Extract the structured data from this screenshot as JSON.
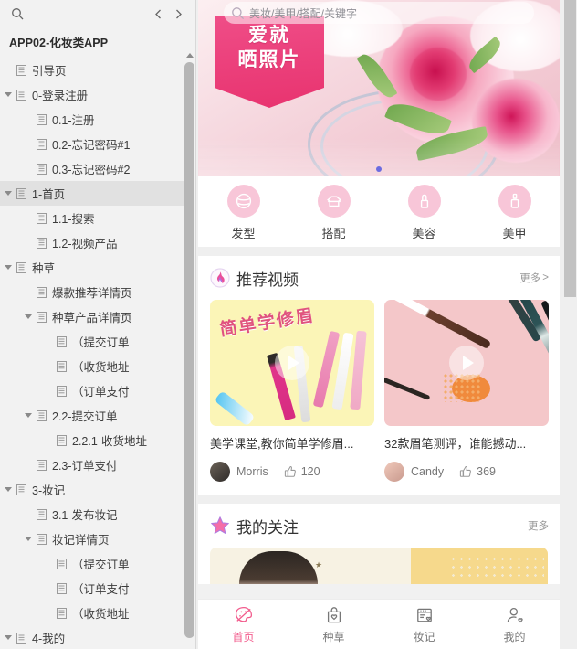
{
  "sidebar": {
    "search_icon": "search-icon",
    "nav_back_icon": "chevron-left-icon",
    "nav_forward_icon": "chevron-right-icon",
    "project_title": "APP02-化妆类APP",
    "tree": [
      {
        "label": "引导页",
        "depth": 1,
        "toggle": "none",
        "selected": false
      },
      {
        "label": "0-登录注册",
        "depth": 1,
        "toggle": "open",
        "selected": false
      },
      {
        "label": "0.1-注册",
        "depth": 2,
        "toggle": "none",
        "selected": false
      },
      {
        "label": "0.2-忘记密码#1",
        "depth": 2,
        "toggle": "none",
        "selected": false
      },
      {
        "label": "0.3-忘记密码#2",
        "depth": 2,
        "toggle": "none",
        "selected": false
      },
      {
        "label": "1-首页",
        "depth": 1,
        "toggle": "open",
        "selected": true
      },
      {
        "label": "1.1-搜索",
        "depth": 2,
        "toggle": "none",
        "selected": false
      },
      {
        "label": "1.2-视频产品",
        "depth": 2,
        "toggle": "none",
        "selected": false
      },
      {
        "label": "种草",
        "depth": 1,
        "toggle": "open",
        "selected": false
      },
      {
        "label": "爆款推荐详情页",
        "depth": 2,
        "toggle": "none",
        "selected": false
      },
      {
        "label": "种草产品详情页",
        "depth": 2,
        "toggle": "open",
        "selected": false
      },
      {
        "label": "（提交订单",
        "depth": 3,
        "toggle": "none",
        "selected": false
      },
      {
        "label": "（收货地址",
        "depth": 3,
        "toggle": "none",
        "selected": false
      },
      {
        "label": "（订单支付",
        "depth": 3,
        "toggle": "none",
        "selected": false
      },
      {
        "label": "2.2-提交订单",
        "depth": 2,
        "toggle": "open",
        "selected": false
      },
      {
        "label": "2.2.1-收货地址",
        "depth": 3,
        "toggle": "none",
        "selected": false
      },
      {
        "label": "2.3-订单支付",
        "depth": 2,
        "toggle": "none",
        "selected": false
      },
      {
        "label": "3-妆记",
        "depth": 1,
        "toggle": "open",
        "selected": false
      },
      {
        "label": "3.1-发布妆记",
        "depth": 2,
        "toggle": "none",
        "selected": false
      },
      {
        "label": "妆记详情页",
        "depth": 2,
        "toggle": "open",
        "selected": false
      },
      {
        "label": "（提交订单",
        "depth": 3,
        "toggle": "none",
        "selected": false
      },
      {
        "label": "（订单支付",
        "depth": 3,
        "toggle": "none",
        "selected": false
      },
      {
        "label": "（收货地址",
        "depth": 3,
        "toggle": "none",
        "selected": false
      },
      {
        "label": "4-我的",
        "depth": 1,
        "toggle": "open",
        "selected": false
      }
    ]
  },
  "preview": {
    "search": {
      "placeholder": "美妆/美甲/搭配/关键字",
      "icon": "search-icon"
    },
    "banner": {
      "badge_line1": "爱就",
      "badge_line2": "晒照片",
      "dot_count": 1,
      "dot_color": "#6b6be0"
    },
    "categories": [
      {
        "label": "发型",
        "icon": "hair-icon"
      },
      {
        "label": "搭配",
        "icon": "outfit-icon"
      },
      {
        "label": "美容",
        "icon": "lipstick-icon"
      },
      {
        "label": "美甲",
        "icon": "nailpolish-icon"
      }
    ],
    "video_section": {
      "icon": "flame-icon",
      "title": "推荐视频",
      "more": "更多",
      "more_chevron": ">",
      "cards": [
        {
          "thumb_text": "简单学修眉",
          "title": "美学课堂,教你简单学修眉...",
          "author": "Morris",
          "likes": "120",
          "like_icon": "thumbs-up-icon",
          "play_icon": "play-icon"
        },
        {
          "thumb_text": "",
          "title": "32款眉笔测评，谁能撼动...",
          "author": "Candy",
          "likes": "369",
          "like_icon": "thumbs-up-icon",
          "play_icon": "play-icon"
        }
      ]
    },
    "follow_section": {
      "icon": "star-icon",
      "title": "我的关注",
      "more": "更多"
    },
    "tabbar": [
      {
        "label": "首页",
        "icon": "home-palette-icon",
        "active": true
      },
      {
        "label": "种草",
        "icon": "bag-heart-icon",
        "active": false
      },
      {
        "label": "妆记",
        "icon": "note-heart-icon",
        "active": false
      },
      {
        "label": "我的",
        "icon": "user-heart-icon",
        "active": false
      }
    ],
    "accent_color": "#f25c8d"
  }
}
